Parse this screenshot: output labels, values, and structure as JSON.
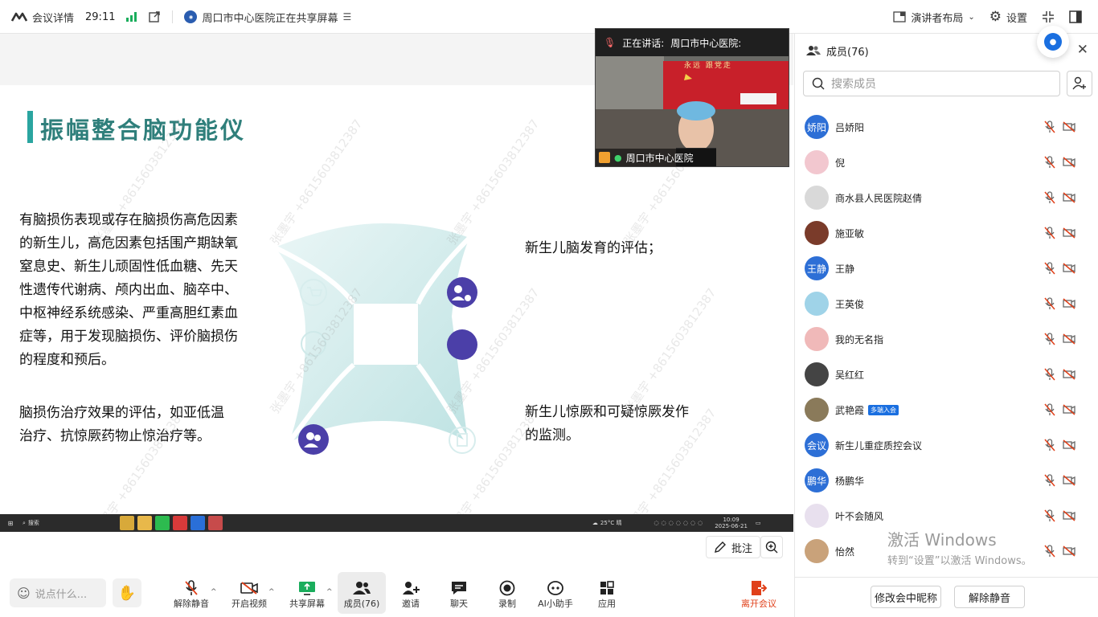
{
  "topbar": {
    "details_label": "会议详情",
    "timer": "29:11",
    "sharing_text": "周口市中心医院正在共享屏幕",
    "layout_label": "演讲者布局",
    "settings_label": "设置"
  },
  "slide": {
    "title": "振幅整合脑功能仪",
    "left_top_lines": [
      "有脑损伤表现或存在脑损伤高危因素",
      "的新生儿，高危因素包括围产期缺氧",
      "窒息史、新生儿顽固性低血糖、先天",
      "性遗传代谢病、颅内出血、脑卒中、",
      "中枢神经系统感染、严重高胆红素血",
      "症等，用于发现脑损伤、评价脑损伤",
      "的程度和预后。"
    ],
    "left_bottom_lines": [
      "脑损伤治疗效果的评估，如亚低温",
      "治疗、抗惊厥药物止惊治疗等。"
    ],
    "right_top_lines": [
      "新生儿脑发育的评估；"
    ],
    "right_bottom_lines": [
      "新生儿惊厥和可疑惊厥发作",
      "的监测。"
    ],
    "watermark": "张墨宇 +8615603812387",
    "taskbar_search": "搜索",
    "taskbar_weather": "25°C 晴",
    "taskbar_time": "10:09",
    "taskbar_date": "2025-06-21"
  },
  "camera": {
    "speaking_label": "正在讲话:",
    "speaker": "周口市中心医院:",
    "name": "周口市中心医院",
    "banner": "永远 跟党走"
  },
  "annotate_label": "批注",
  "sidebar": {
    "title": "成员(76)",
    "search_placeholder": "搜索成员",
    "members": [
      {
        "avatar": "娇阳",
        "name": "吕娇阳",
        "color": "#2d6fd6",
        "tag": ""
      },
      {
        "avatar": "",
        "name": "倪",
        "color": "#f2c7cf",
        "tag": ""
      },
      {
        "avatar": "",
        "name": "商水县人民医院赵倩",
        "color": "#d9d9d9",
        "tag": ""
      },
      {
        "avatar": "",
        "name": "施亚敏",
        "color": "#7a3b2a",
        "tag": ""
      },
      {
        "avatar": "王静",
        "name": "王静",
        "color": "#2d6fd6",
        "tag": ""
      },
      {
        "avatar": "",
        "name": "王英俊",
        "color": "#9fd3e8",
        "tag": ""
      },
      {
        "avatar": "",
        "name": "我的无名指",
        "color": "#f0b9b9",
        "tag": ""
      },
      {
        "avatar": "",
        "name": "吴红红",
        "color": "#444444",
        "tag": ""
      },
      {
        "avatar": "",
        "name": "武艳霞",
        "color": "#8a7a5a",
        "tag": "多端入会"
      },
      {
        "avatar": "会议",
        "name": "新生儿重症质控会议",
        "color": "#2d6fd6",
        "tag": ""
      },
      {
        "avatar": "鹏华",
        "name": "杨鹏华",
        "color": "#2d6fd6",
        "tag": ""
      },
      {
        "avatar": "",
        "name": "叶不会随风",
        "color": "#e8e0ee",
        "tag": ""
      },
      {
        "avatar": "",
        "name": "怡然",
        "color": "#c9a27a",
        "tag": ""
      }
    ],
    "rename_label": "修改会中昵称",
    "unmute_all_label": "解除静音"
  },
  "windows_activation": {
    "line1": "激活 Windows",
    "line2": "转到“设置”以激活 Windows。"
  },
  "toolbar": {
    "say_placeholder": "说点什么...",
    "items": [
      {
        "label": "解除静音"
      },
      {
        "label": "开启视频"
      },
      {
        "label": "共享屏幕"
      },
      {
        "label": "成员(76)"
      },
      {
        "label": "邀请"
      },
      {
        "label": "聊天"
      },
      {
        "label": "录制"
      },
      {
        "label": "AI小助手"
      },
      {
        "label": "应用"
      }
    ],
    "leave_label": "离开会议"
  },
  "colors": {
    "accent": "#2d6fd6",
    "title_teal": "#2f7f7b",
    "leave_red": "#e0401a"
  }
}
